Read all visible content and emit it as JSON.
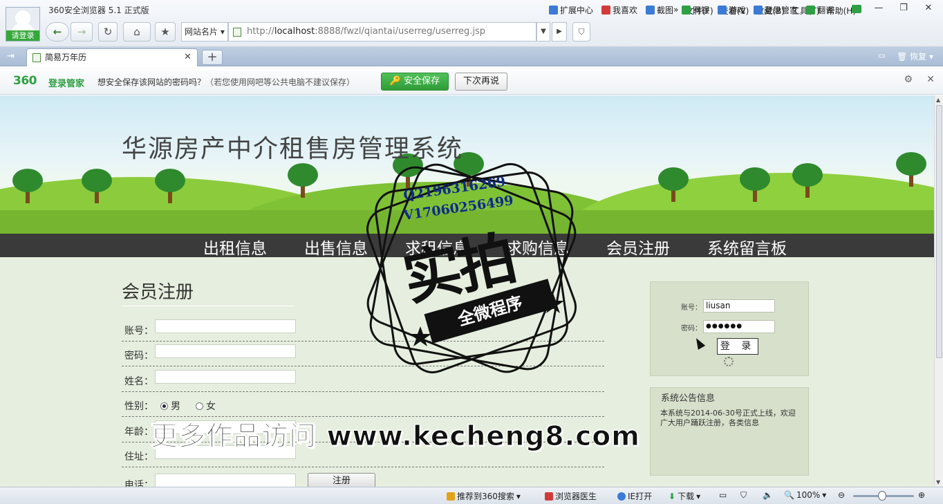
{
  "browser": {
    "login_badge": "请登录",
    "title": "360安全浏览器 5.1 正式版",
    "menu": [
      "文件(F)",
      "查看(V)",
      "收藏(B)",
      "工具(T)",
      "帮助(H)"
    ],
    "site_card": "网站名片",
    "url_prefix": "http://",
    "url_host": "localhost",
    "url_rest": ":8888/fwzl/qiantai/userreg/userreg.jsp",
    "extensions": [
      {
        "label": "扩展中心",
        "color": "#3b7bd6"
      },
      {
        "label": "我喜欢",
        "color": "#d23b3b"
      },
      {
        "label": "截图",
        "color": "#3b7bd6"
      },
      {
        "label": "网银",
        "color": "#2ea043"
      },
      {
        "label": "游戏",
        "color": "#3b7bd6"
      },
      {
        "label": "登录管家",
        "color": "#3b7bd6"
      },
      {
        "label": "翻译",
        "color": "#2ea043"
      }
    ],
    "tab_title": "简易万年历",
    "tab_restore": "恢复",
    "password_bar": {
      "logo": "360",
      "logo_sub": "登录管家",
      "message": "想安全保存该网站的密码吗？",
      "hint": "（若您使用网吧等公共电脑不建议保存）",
      "save_label": "安全保存",
      "later_label": "下次再说"
    },
    "status": {
      "recommend": "推荐到360搜索",
      "doctor": "浏览器医生",
      "ie_open": "IE打开",
      "download": "下载",
      "zoom": "100%"
    }
  },
  "site": {
    "title": "华源房产中介租售房管理系统",
    "nav": [
      "出租信息",
      "出售信息",
      "求租信息",
      "求购信息",
      "会员注册",
      "系统留言板"
    ],
    "register": {
      "heading": "会员注册",
      "fields": [
        "账号：",
        "密码：",
        "姓名：",
        "性别：",
        "年龄：",
        "住址：",
        "电话："
      ],
      "gender_male": "男",
      "gender_female": "女",
      "submit_label": "注册"
    },
    "login": {
      "account_label": "账号：",
      "account_value": "liusan",
      "password_label": "密码：",
      "password_value": "●●●●●●",
      "button_label": "登 录"
    },
    "notice": {
      "title": "系统公告信息",
      "body": "本系统与2014-06-30号正式上线，欢迎广大用户踊跃注册，各类信息"
    }
  },
  "watermark": {
    "qq": "Q2196316269",
    "wechat": "V17060256499",
    "big": "实拍",
    "ribbon": "全微程序",
    "promo": "更多作品访问 www.kecheng8.com"
  }
}
